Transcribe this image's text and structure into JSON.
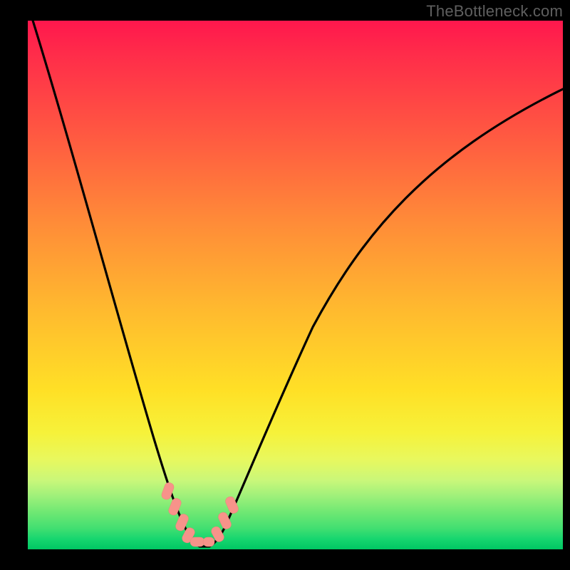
{
  "watermark": "TheBottleneck.com",
  "colors": {
    "background": "#000000",
    "curve": "#000000",
    "marker": "#f7938a",
    "gradient_top": "#ff174d",
    "gradient_bottom": "#00c763"
  },
  "chart_data": {
    "type": "line",
    "title": "",
    "xlabel": "",
    "ylabel": "",
    "xlim": [
      0,
      100
    ],
    "ylim": [
      0,
      100
    ],
    "x": [
      0,
      3,
      6,
      9,
      12,
      15,
      18,
      21,
      24,
      27,
      28,
      30,
      33,
      36,
      40,
      45,
      50,
      55,
      60,
      65,
      70,
      75,
      80,
      85,
      90,
      95,
      100
    ],
    "values": [
      100,
      90,
      80,
      70,
      60,
      50,
      40,
      30,
      19,
      8,
      3,
      0,
      0,
      3,
      11,
      22,
      32,
      41,
      49,
      56,
      62,
      68,
      73,
      77,
      81,
      84,
      87
    ],
    "series": [
      {
        "name": "bottleneck-curve",
        "x": [
          0,
          3,
          6,
          9,
          12,
          15,
          18,
          21,
          24,
          27,
          28,
          30,
          33,
          36,
          40,
          45,
          50,
          55,
          60,
          65,
          70,
          75,
          80,
          85,
          90,
          95,
          100
        ],
        "values": [
          100,
          90,
          80,
          70,
          60,
          50,
          40,
          30,
          19,
          8,
          3,
          0,
          0,
          3,
          11,
          22,
          32,
          41,
          49,
          56,
          62,
          68,
          73,
          77,
          81,
          84,
          87
        ]
      }
    ],
    "markers": [
      {
        "x": 26,
        "y": 11
      },
      {
        "x": 27,
        "y": 7
      },
      {
        "x": 28,
        "y": 4
      },
      {
        "x": 29,
        "y": 2
      },
      {
        "x": 30,
        "y": 1
      },
      {
        "x": 31,
        "y": 0
      },
      {
        "x": 35,
        "y": 2
      },
      {
        "x": 36,
        "y": 4
      },
      {
        "x": 37,
        "y": 6
      }
    ]
  }
}
